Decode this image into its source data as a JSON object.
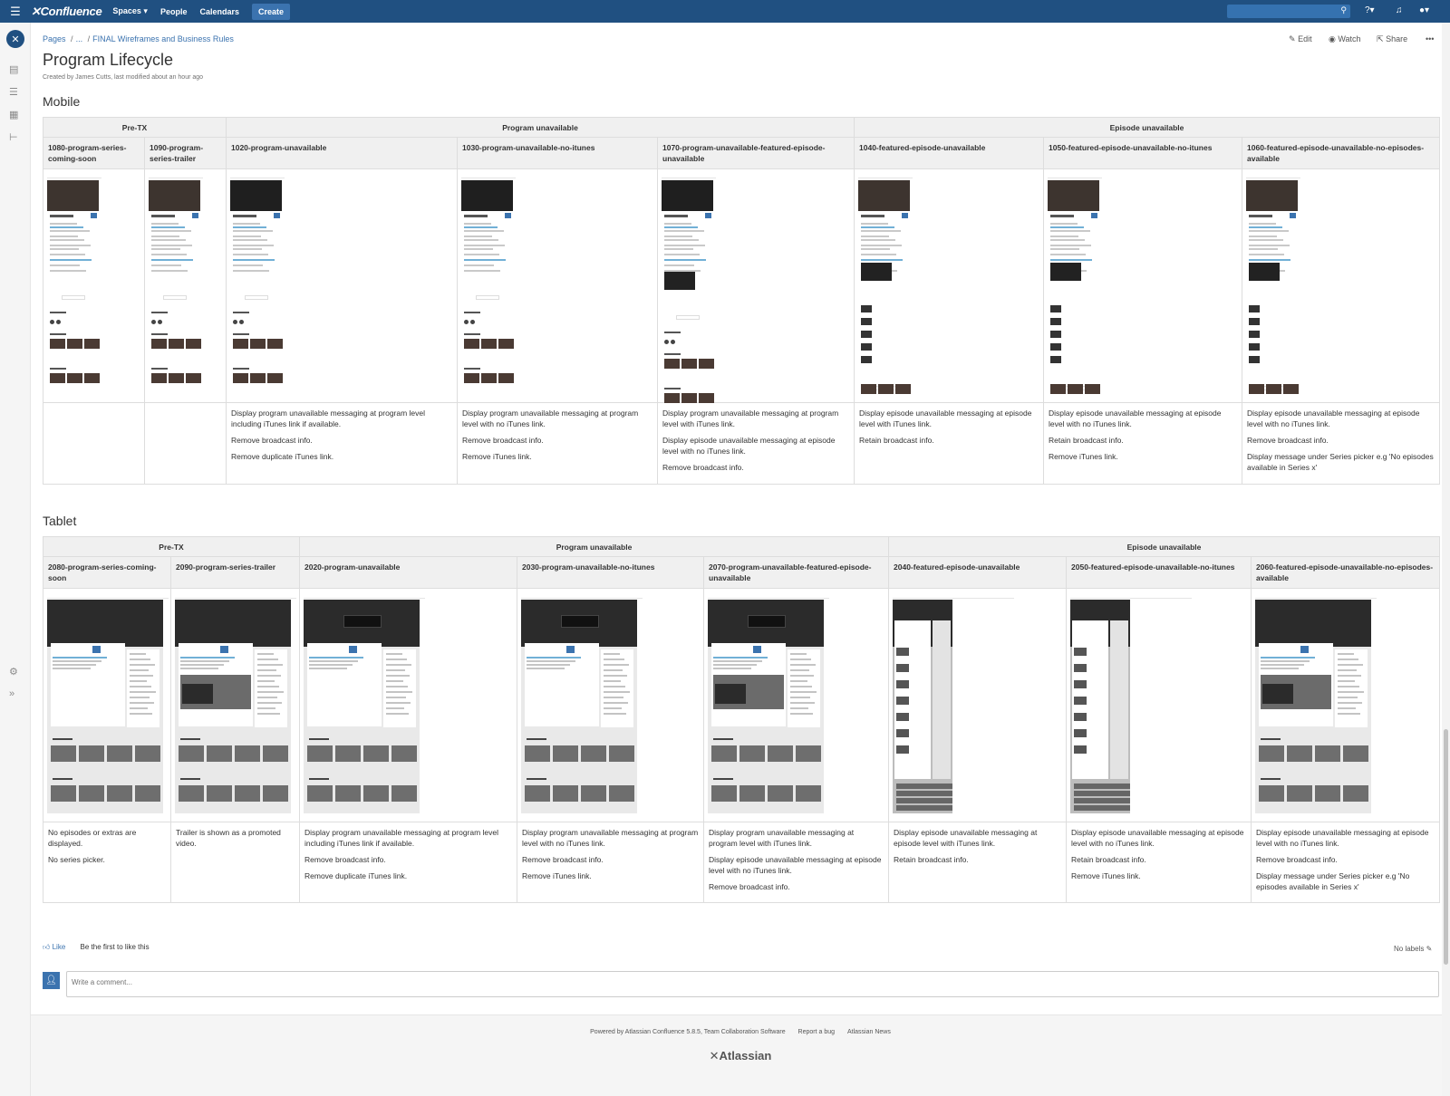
{
  "nav": {
    "logo": "Confluence",
    "spaces": "Spaces ▾",
    "people": "People",
    "calendars": "Calendars",
    "create": "Create"
  },
  "breadcrumb": {
    "pages": "Pages",
    "ellipsis": "...",
    "parent": "FINAL Wireframes and Business Rules"
  },
  "actions": {
    "edit": "Edit",
    "watch": "Watch",
    "share": "Share"
  },
  "page": {
    "title": "Program Lifecycle",
    "byline": "Created by James Cutts, last modified about an hour ago"
  },
  "mobile": {
    "heading": "Mobile",
    "groups": [
      "Pre-TX",
      "Program unavailable",
      "Episode unavailable"
    ],
    "columns": [
      "1080-program-series-coming-soon",
      "1090-program-series-trailer",
      "1020-program-unavailable",
      "1030-program-unavailable-no-itunes",
      "1070-program-unavailable-featured-episode-unavailable",
      "1040-featured-episode-unavailable",
      "1050-featured-episode-unavailable-no-itunes",
      "1060-featured-episode-unavailable-no-episodes-available"
    ],
    "descriptions": [
      [],
      [],
      [
        "Display program unavailable messaging at program level including iTunes link if available.",
        "Remove broadcast info.",
        "Remove duplicate iTunes link."
      ],
      [
        "Display program unavailable messaging at program level with no iTunes link.",
        "Remove broadcast info.",
        "Remove iTunes link."
      ],
      [
        "Display program unavailable messaging at program level with iTunes link.",
        "Display episode unavailable messaging at episode level with no iTunes link.",
        "Remove broadcast info."
      ],
      [
        "Display episode unavailable messaging at episode level with iTunes link.",
        "Retain broadcast info."
      ],
      [
        "Display episode unavailable messaging at episode level with no iTunes link.",
        "Retain broadcast info.",
        "Remove iTunes link."
      ],
      [
        "Display episode unavailable messaging at episode level with no iTunes link.",
        "Remove broadcast info.",
        "Display message under Series picker e.g 'No episodes available in Series x'"
      ]
    ]
  },
  "tablet": {
    "heading": "Tablet",
    "groups": [
      "Pre-TX",
      "Program unavailable",
      "Episode unavailable"
    ],
    "columns": [
      "2080-program-series-coming-soon",
      "2090-program-series-trailer",
      "2020-program-unavailable",
      "2030-program-unavailable-no-itunes",
      "2070-program-unavailable-featured-episode-unavailable",
      "2040-featured-episode-unavailable",
      "2050-featured-episode-unavailable-no-itunes",
      "2060-featured-episode-unavailable-no-episodes-available"
    ],
    "descriptions": [
      [
        "No episodes or extras are displayed.",
        "No series picker."
      ],
      [
        "Trailer is shown as a promoted video."
      ],
      [
        "Display program unavailable messaging at program level including iTunes link if available.",
        "Remove broadcast info.",
        "Remove duplicate iTunes link."
      ],
      [
        "Display program unavailable messaging at program level with no iTunes link.",
        "Remove broadcast info.",
        "Remove iTunes link."
      ],
      [
        "Display program unavailable messaging at program level with iTunes link.",
        "Display episode unavailable messaging at episode level with no iTunes link.",
        "Remove broadcast info."
      ],
      [
        "Display episode unavailable messaging at episode level with iTunes link.",
        "Retain broadcast info."
      ],
      [
        "Display episode unavailable messaging at episode level with no iTunes link.",
        "Retain broadcast info.",
        "Remove iTunes link."
      ],
      [
        "Display episode unavailable messaging at episode level with no iTunes link.",
        "Remove broadcast info.",
        "Display message under Series picker e.g 'No episodes available in Series x'"
      ]
    ]
  },
  "likes": {
    "like": "Like",
    "first": "Be the first to like this",
    "labels": "No labels"
  },
  "comment": {
    "placeholder": "Write a comment..."
  },
  "footer": {
    "powered": "Powered by Atlassian Confluence 5.8.5, Team Collaboration Software",
    "bug": "Report a bug",
    "news": "Atlassian News",
    "brand": "Atlassian"
  },
  "colors": {
    "nav": "#205081",
    "link": "#3b73af",
    "header_bg": "#f0f0f0"
  }
}
